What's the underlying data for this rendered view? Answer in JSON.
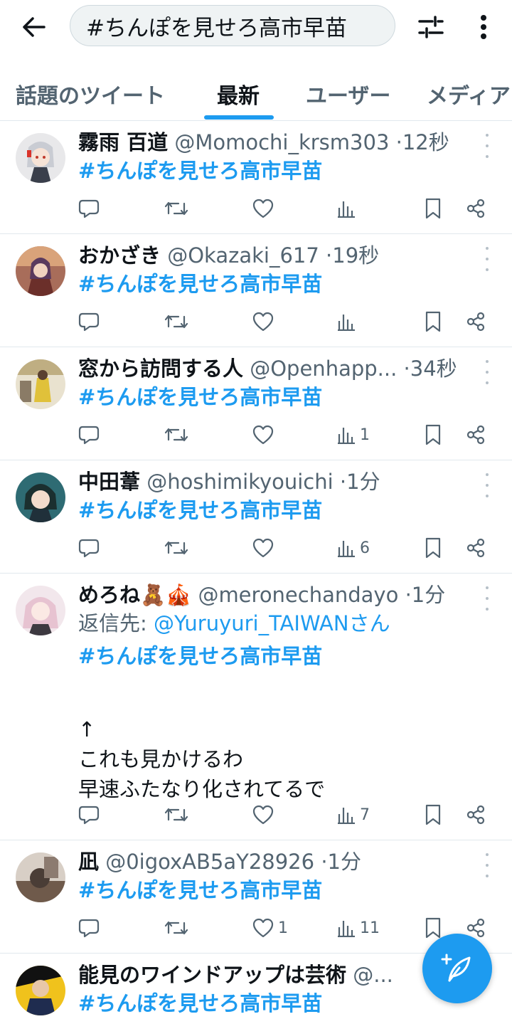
{
  "topbar": {
    "search_value": "#ちんぽを見せろ高市早苗",
    "back_icon": "arrow-left-icon",
    "filter_icon": "sliders-icon",
    "more_icon": "more-vertical-icon"
  },
  "tabs": [
    {
      "label": "話題のツイート",
      "active": false
    },
    {
      "label": "最新",
      "active": true
    },
    {
      "label": "ユーザー",
      "active": false
    },
    {
      "label": "メディア",
      "active": false
    }
  ],
  "accent_color": "#1d9bf0",
  "tweets": [
    {
      "name": "霧雨 百道",
      "handle": "@Momochi_krsm303",
      "time": "12秒",
      "hashtag": "#ちんぽを見せろ高市早苗",
      "likes": "",
      "views": ""
    },
    {
      "name": "おかざき",
      "handle": "@Okazaki_617",
      "time": "19秒",
      "hashtag": "#ちんぽを見せろ高市早苗",
      "likes": "",
      "views": ""
    },
    {
      "name": "窓から訪問する人",
      "handle": "@Openhapp...",
      "time": "34秒",
      "hashtag": "#ちんぽを見せろ高市早苗",
      "likes": "",
      "views": "1"
    },
    {
      "name": "中田葦",
      "handle": "@hoshimikyouichi",
      "time": "1分",
      "hashtag": "#ちんぽを見せろ高市早苗",
      "likes": "",
      "views": "6"
    },
    {
      "name": "めろね🧸🎪",
      "handle": "@meronechandayo",
      "time": "1分",
      "reply_prefix": "返信先: ",
      "reply_handle": "@Yuruyuri_TAIWANさん",
      "hashtag": "#ちんぽを見せろ高市早苗",
      "body_lines": [
        "↑",
        "これも見かけるわ",
        "早速ふたなり化されてるで"
      ],
      "likes": "",
      "views": "7"
    },
    {
      "name": "凪",
      "handle": "@0igoxAB5aY28926",
      "time": "1分",
      "hashtag": "#ちんぽを見せろ高市早苗",
      "likes": "1",
      "views": "11"
    },
    {
      "name": "能見のワインドアップは芸術",
      "handle": "@...",
      "time": "",
      "hashtag": "#ちんぽを見せろ高市早苗",
      "likes": "",
      "views": ""
    }
  ]
}
